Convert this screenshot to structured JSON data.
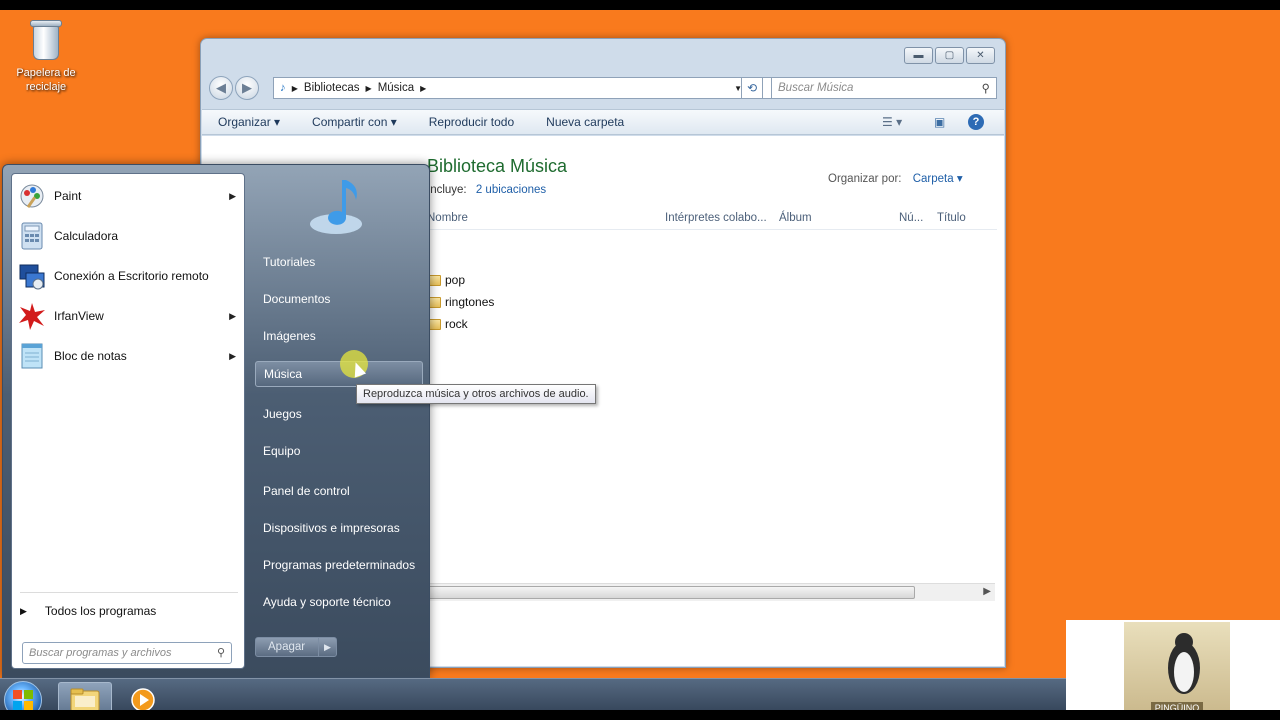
{
  "desktop": {
    "recycle_bin_label": "Papelera de reciclaje"
  },
  "explorer": {
    "address": {
      "crumbs": [
        "Bibliotecas",
        "Música"
      ]
    },
    "search_placeholder": "Buscar Música",
    "toolbar": {
      "organize": "Organizar ▾",
      "share": "Compartir con ▾",
      "play_all": "Reproducir todo",
      "new_folder": "Nueva carpeta"
    },
    "library_title": "Biblioteca Música",
    "includes_label": "Incluye:",
    "includes_link": "2 ubicaciones",
    "arrange_label": "Organizar por:",
    "arrange_value": "Carpeta ▾",
    "columns": [
      "Nombre",
      "Intérpretes colabo...",
      "Álbum",
      "Nú...",
      "Título"
    ],
    "files": [
      "pop",
      "ringtones",
      "rock"
    ]
  },
  "start_menu": {
    "programs": [
      {
        "label": "Paint",
        "icon": "paint-icon",
        "has_submenu": true
      },
      {
        "label": "Calculadora",
        "icon": "calculator-icon",
        "has_submenu": false
      },
      {
        "label": "Conexión a Escritorio remoto",
        "icon": "remote-desktop-icon",
        "has_submenu": false
      },
      {
        "label": "IrfanView",
        "icon": "irfanview-icon",
        "has_submenu": true
      },
      {
        "label": "Bloc de notas",
        "icon": "notepad-icon",
        "has_submenu": true
      }
    ],
    "all_programs": "Todos los programas",
    "search_placeholder": "Buscar programas y archivos",
    "right_items": [
      "Tutoriales",
      "Documentos",
      "Imágenes",
      "Música",
      "Juegos",
      "Equipo",
      "Panel de control",
      "Dispositivos e impresoras",
      "Programas predeterminados",
      "Ayuda y soporte técnico"
    ],
    "highlighted_item": "Música",
    "shutdown_label": "Apagar",
    "tooltip": "Reproduzca música y otros archivos de audio."
  },
  "taskbar": {
    "pinned": [
      "explorer-icon",
      "media-player-icon"
    ]
  },
  "colors": {
    "desktop": "#f97a1d",
    "library_title": "#1e6b2f",
    "link": "#1f5fa8"
  }
}
